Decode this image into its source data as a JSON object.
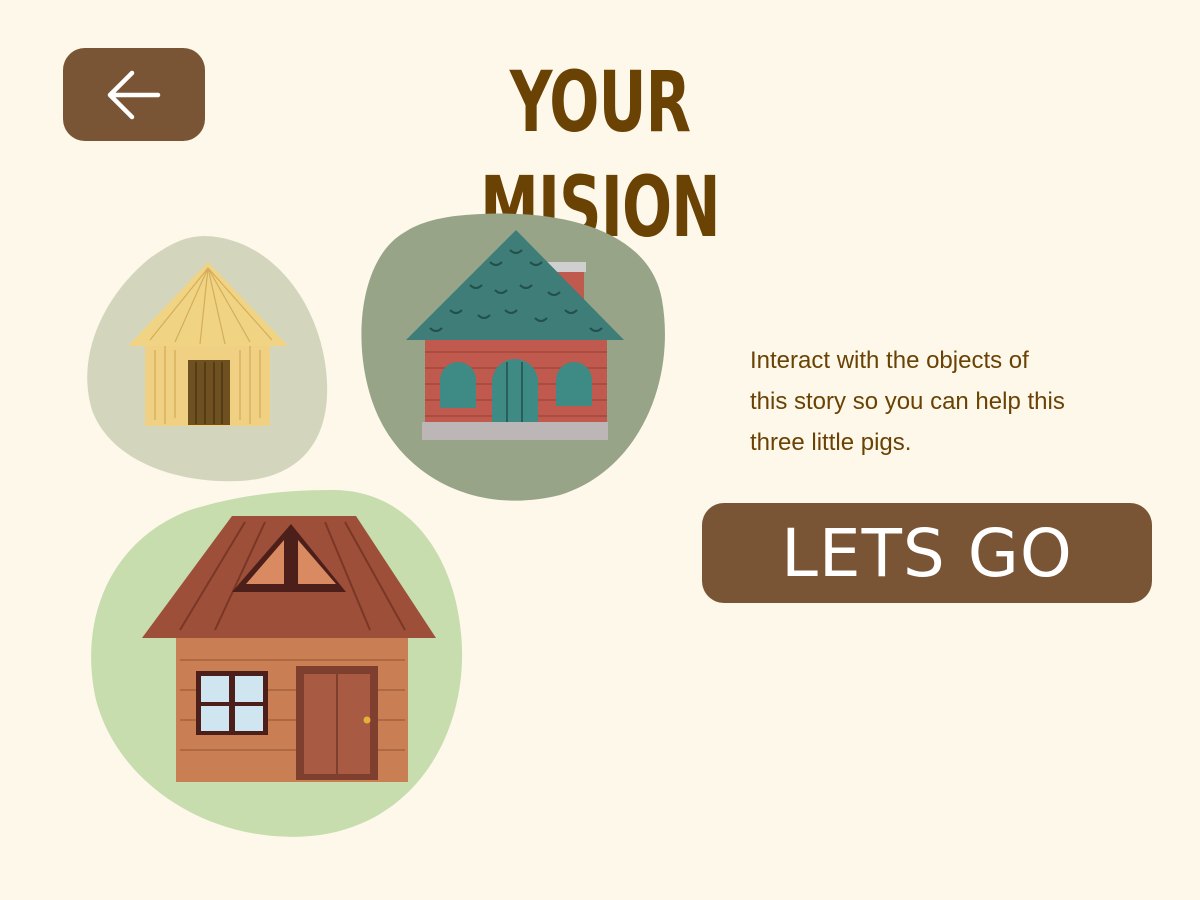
{
  "header": {
    "back_icon": "arrow-left-icon",
    "title": "YOUR MISION"
  },
  "scene": {
    "houses": [
      {
        "name": "straw house",
        "icon": "straw-house-icon",
        "blob_color": "#d3d6bc"
      },
      {
        "name": "brick house",
        "icon": "brick-house-icon",
        "blob_color": "#97a488"
      },
      {
        "name": "wood house",
        "icon": "wood-house-icon",
        "blob_color": "#c7ddae"
      }
    ]
  },
  "mission": {
    "description": "Interact with the objects of\nthis story so you can help this\n three little pigs.",
    "button_label": "LETS GO"
  },
  "colors": {
    "background": "#fdf8ea",
    "button": "#7a5535",
    "title": "#6a4204"
  }
}
